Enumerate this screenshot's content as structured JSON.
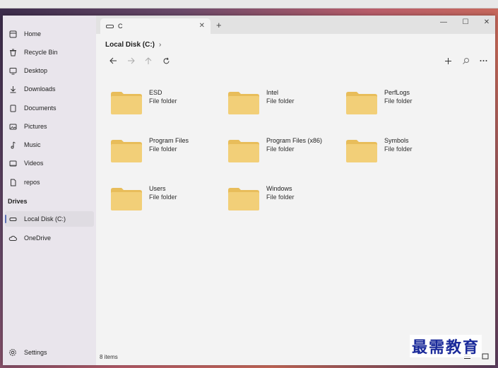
{
  "window": {
    "tab_title": "C",
    "current_location": "Local Disk (C:)"
  },
  "sidebar": {
    "items": [
      {
        "label": "Home",
        "icon": "home-icon"
      },
      {
        "label": "Recycle Bin",
        "icon": "recycle-bin-icon"
      },
      {
        "label": "Desktop",
        "icon": "desktop-icon"
      },
      {
        "label": "Downloads",
        "icon": "download-icon"
      },
      {
        "label": "Documents",
        "icon": "document-icon"
      },
      {
        "label": "Pictures",
        "icon": "picture-icon"
      },
      {
        "label": "Music",
        "icon": "music-icon"
      },
      {
        "label": "Videos",
        "icon": "video-icon"
      },
      {
        "label": "repos",
        "icon": "file-icon"
      }
    ],
    "drives_title": "Drives",
    "drives": [
      {
        "label": "Local Disk (C:)",
        "icon": "drive-icon",
        "selected": true
      },
      {
        "label": "OneDrive",
        "icon": "cloud-icon"
      }
    ],
    "settings_label": "Settings"
  },
  "folders": [
    {
      "name": "ESD",
      "type": "File folder"
    },
    {
      "name": "Intel",
      "type": "File folder"
    },
    {
      "name": "PerfLogs",
      "type": "File folder"
    },
    {
      "name": "Program Files",
      "type": "File folder"
    },
    {
      "name": "Program Files (x86)",
      "type": "File folder"
    },
    {
      "name": "Symbols",
      "type": "File folder"
    },
    {
      "name": "Users",
      "type": "File folder"
    },
    {
      "name": "Windows",
      "type": "File folder"
    }
  ],
  "status": {
    "item_count": "8 items"
  },
  "watermark": "最需教育",
  "colors": {
    "folder": "#f2cf78",
    "folder_tab": "#e8bd5a",
    "accent": "#5a6fb5"
  }
}
